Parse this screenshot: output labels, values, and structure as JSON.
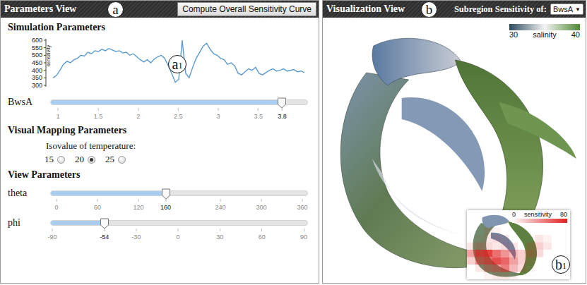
{
  "parameters_view": {
    "title": "Parameters View",
    "marker": {
      "letter": "a"
    },
    "button": "Compute Overall Sensitivity Curve",
    "simulation": {
      "heading": "Simulation Parameters",
      "chart": {
        "y_label": "sensitivity",
        "y_ticks": [
          "600",
          "550",
          "500",
          "450",
          "400",
          "350",
          "300"
        ],
        "y_min": 300,
        "y_max": 600,
        "series": [
          350,
          365,
          400,
          440,
          460,
          450,
          470,
          480,
          500,
          495,
          520,
          510,
          530,
          525,
          540,
          530,
          545,
          535,
          525,
          530,
          515,
          520,
          500,
          510,
          490,
          470,
          455,
          470,
          450,
          475,
          490,
          500,
          480,
          430,
          380,
          320,
          340,
          600,
          380,
          350,
          420,
          480,
          520,
          560,
          580,
          540,
          510,
          500,
          480,
          470,
          440,
          450,
          430,
          380,
          370,
          390,
          410,
          400,
          420,
          380,
          370,
          385,
          400,
          410,
          395,
          400,
          410,
          395,
          400,
          405,
          390,
          395,
          385
        ],
        "marker": {
          "letter": "a",
          "sub": "1"
        }
      },
      "slider": {
        "name": "BwsA",
        "level": 0.9,
        "reading": "3.8",
        "min": 0.9,
        "max": 4.12,
        "ticks": [
          "1",
          "1.5",
          "2",
          "2.5",
          "3",
          "3.5"
        ]
      }
    },
    "visual_mapping": {
      "heading": "Visual Mapping Parameters",
      "label": "Isovalue of temperature:",
      "options": [
        {
          "label": "15",
          "selected": false
        },
        {
          "label": "20",
          "selected": true
        },
        {
          "label": "25",
          "selected": false
        }
      ]
    },
    "view": {
      "heading": "View Parameters",
      "sliders": [
        {
          "name": "theta",
          "level": 0.448,
          "reading": "160",
          "min": -9.3,
          "max": 368.3,
          "ticks": [
            "0",
            "60",
            "120",
            "240",
            "300",
            "360"
          ]
        },
        {
          "name": "phi",
          "level": 0.21,
          "reading": "-54",
          "min": -91.5,
          "max": 93,
          "ticks": [
            "-90",
            "-30",
            "0",
            "30",
            "60",
            "90"
          ]
        }
      ]
    }
  },
  "visualization_view": {
    "title": "Visualization View",
    "marker": {
      "letter": "b"
    },
    "selector_label": "Subregion Sensitivity of:",
    "selector_value": "BwsA",
    "selector_arrow": "▼",
    "legend": {
      "label": "salinity",
      "min": "30",
      "max": "40"
    },
    "inset": {
      "legend": {
        "label": "sensitivity",
        "min": "0",
        "max": "80"
      },
      "grid": [
        [
          0,
          0,
          0,
          0,
          0,
          0,
          0,
          0,
          0,
          0
        ],
        [
          0,
          0,
          10,
          5,
          0,
          0,
          0,
          0,
          0,
          0
        ],
        [
          0,
          5,
          10,
          15,
          10,
          0,
          0,
          0,
          10,
          5
        ],
        [
          10,
          20,
          15,
          10,
          15,
          10,
          0,
          15,
          20,
          10
        ],
        [
          40,
          70,
          80,
          60,
          45,
          30,
          20,
          25,
          15,
          0
        ],
        [
          20,
          50,
          60,
          75,
          65,
          40,
          20,
          10,
          0,
          0
        ],
        [
          0,
          10,
          30,
          40,
          55,
          30,
          15,
          5,
          0,
          0
        ],
        [
          0,
          0,
          5,
          10,
          10,
          5,
          0,
          0,
          0,
          0
        ]
      ],
      "marker": {
        "letter": "b",
        "sub": "1"
      }
    }
  }
}
